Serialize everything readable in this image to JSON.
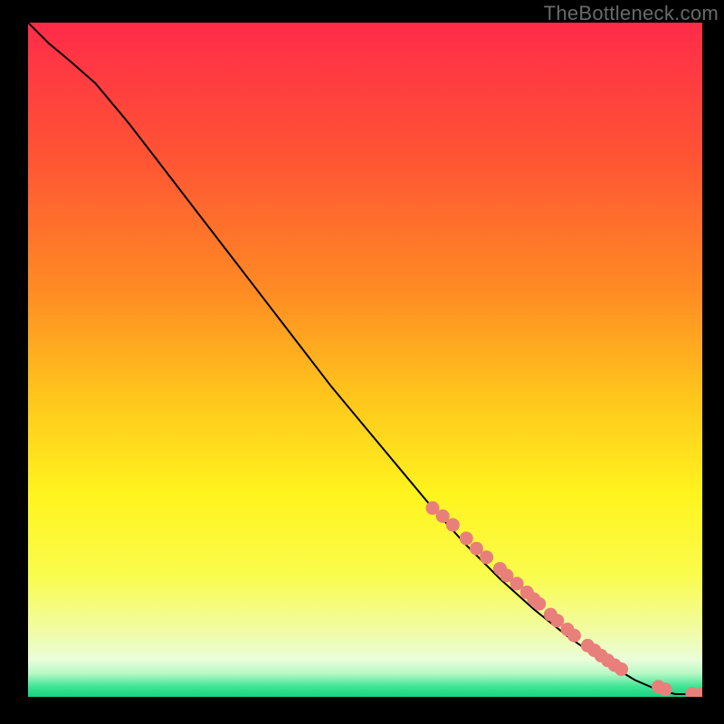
{
  "watermark": "TheBottleneck.com",
  "colors": {
    "marker": "#e97f7b",
    "line": "#000000"
  },
  "gradient_stops": [
    {
      "offset": 0.0,
      "color": "#ff2b49"
    },
    {
      "offset": 0.2,
      "color": "#ff5434"
    },
    {
      "offset": 0.4,
      "color": "#ff8c23"
    },
    {
      "offset": 0.55,
      "color": "#ffc41c"
    },
    {
      "offset": 0.7,
      "color": "#fff41e"
    },
    {
      "offset": 0.82,
      "color": "#fafc4d"
    },
    {
      "offset": 0.9,
      "color": "#f1fca2"
    },
    {
      "offset": 0.945,
      "color": "#eafdda"
    },
    {
      "offset": 0.965,
      "color": "#b8f9c6"
    },
    {
      "offset": 0.985,
      "color": "#3de594"
    },
    {
      "offset": 1.0,
      "color": "#17d380"
    }
  ],
  "chart_data": {
    "type": "line",
    "title": "",
    "xlabel": "",
    "ylabel": "",
    "xlim": [
      0,
      100
    ],
    "ylim": [
      0,
      100
    ],
    "series": [
      {
        "name": "curve",
        "x": [
          0,
          3,
          6,
          10,
          15,
          20,
          25,
          30,
          35,
          40,
          45,
          50,
          55,
          60,
          65,
          70,
          75,
          80,
          85,
          90,
          93,
          96,
          98,
          100
        ],
        "y": [
          100,
          97,
          94.5,
          91,
          85,
          78.5,
          72,
          65.5,
          59,
          52.5,
          46,
          40,
          34,
          28,
          22.5,
          17.5,
          13,
          9,
          5.5,
          2.5,
          1.2,
          0.4,
          0.4,
          0.4
        ]
      }
    ],
    "markers": {
      "name": "highlighted-points",
      "x": [
        60,
        61.5,
        63,
        65,
        66.5,
        68,
        70,
        71,
        72.5,
        74,
        75,
        75.8,
        77.5,
        78.5,
        80,
        81,
        83,
        84,
        85,
        86,
        87,
        88,
        93.5,
        94.5,
        98.5,
        100
      ],
      "y": [
        28,
        26.8,
        25.5,
        23.5,
        22,
        20.7,
        19,
        18,
        16.8,
        15.5,
        14.5,
        13.8,
        12.2,
        11.3,
        10,
        9.1,
        7.6,
        6.9,
        6.1,
        5.4,
        4.7,
        4.1,
        1.5,
        1.1,
        0.45,
        0.45
      ]
    }
  }
}
